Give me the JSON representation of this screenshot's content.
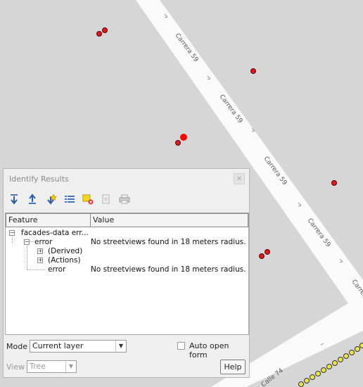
{
  "map": {
    "streets": [
      {
        "name": "Carrera 59"
      },
      {
        "name": "Calle 74"
      }
    ]
  },
  "panel": {
    "title": "Identify Results",
    "toolbar_icons": [
      "expand-tree-icon",
      "collapse-tree-icon",
      "expand-new-results-icon",
      "clear-results-icon",
      "clear-highlight-icon",
      "copy-icon",
      "print-icon"
    ],
    "columns": [
      "Feature",
      "Value"
    ],
    "rows": [
      {
        "feature": "facades-data err...",
        "value": "",
        "expander": "-"
      },
      {
        "feature": "error",
        "value": "No streetviews found in 18 meters radius.",
        "expander": "-"
      },
      {
        "feature": "(Derived)",
        "value": "",
        "expander": "+"
      },
      {
        "feature": "(Actions)",
        "value": "",
        "expander": "+"
      },
      {
        "feature": "error",
        "value": "No streetviews found in 18 meters radius.",
        "expander": ""
      }
    ],
    "mode_label": "Mode",
    "mode_value": "Current layer",
    "auto_open_label": "Auto open form",
    "auto_open_checked": false,
    "view_label": "View",
    "view_value": "Tree",
    "help_label": "Help"
  }
}
